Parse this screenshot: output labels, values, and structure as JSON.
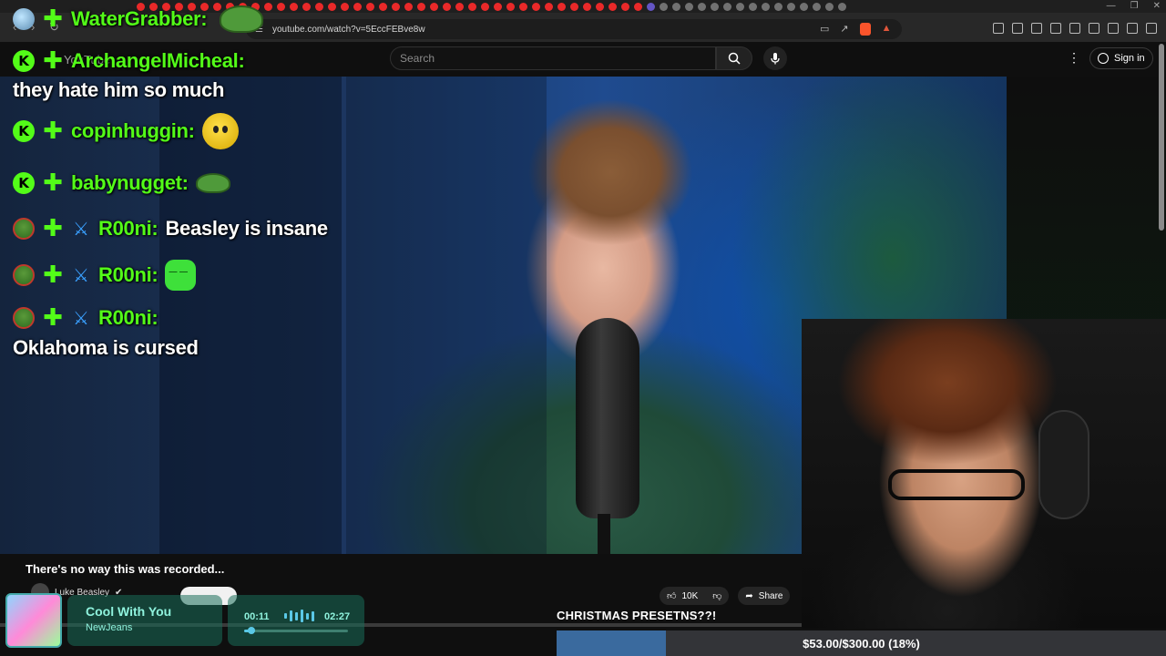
{
  "browser": {
    "url": "youtube.com/watch?v=5EccFEBve8w"
  },
  "youtube": {
    "search_placeholder": "Search",
    "sign_in": "Sign in",
    "logo_text": "YouTube",
    "video_title": "There's no way this was recorded...",
    "channel_name": "Luke Beasley",
    "likes": "10K",
    "share": "Share"
  },
  "streamer": {
    "name": "WaterGrabber:"
  },
  "chat": [
    {
      "user": "ArchangelMicheal:",
      "text": "they hate him so much"
    },
    {
      "user": "copinhuggin:",
      "text": ""
    },
    {
      "user": "babynugget:",
      "text": ""
    },
    {
      "user": "R00ni:",
      "text": "Beasley is insane"
    },
    {
      "user": "R00ni:",
      "text": ""
    },
    {
      "user": "R00ni:",
      "text": "Oklahoma is cursed"
    }
  ],
  "music": {
    "title": "Cool With You",
    "artist": "NewJeans",
    "current": "00:11",
    "total": "02:27",
    "progress": 0.07
  },
  "goal": {
    "label": "CHRISTMAS PRESETNS??!",
    "text": "$53.00/$300.00 (18%)",
    "progress": 0.18
  },
  "colors": {
    "kick_green": "#53fc18",
    "goal_fill": "#3a6a9e",
    "music_text": "#8ff2dd"
  }
}
